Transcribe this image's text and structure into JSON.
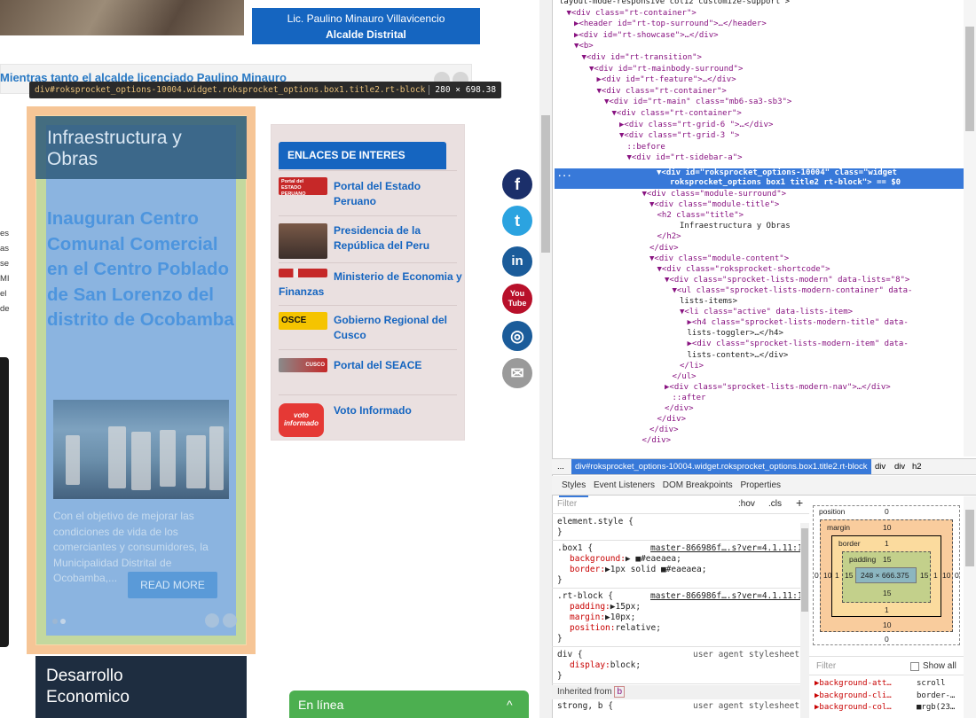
{
  "page": {
    "mayor_name": "Lic. Paulino Minauro Villavicencio",
    "mayor_title": "Alcalde Distrital",
    "ticker_text": "Mientras tanto el alcalde licenciado Paulino Minauro",
    "tooltip_selector": "div#roksprocket_options-10004.widget.roksprocket_options.box1.title2.rt-block",
    "tooltip_size": "280 × 698.38",
    "box_title": "Infraestructura y Obras",
    "article_title": "Inauguran Centro Comunal Comercial en el Centro Poblado de San Lorenzo del distrito de Ocobamba",
    "article_body": "Con el objetivo de mejorar las condiciones de vida de los comerciantes y consumidores, la Municipalidad Distrital de Ocobamba,...",
    "read_more": "READ MORE",
    "left_fragments": [
      "es",
      "as",
      "se",
      "MI",
      "el",
      "de"
    ],
    "links_header": "ENLACES DE INTERES",
    "links": [
      {
        "label": "Portal del Estado Peruano",
        "thumb": "estado-peruano-logo"
      },
      {
        "label": "Presidencia de la República del Peru",
        "thumb": "presidente-photo"
      },
      {
        "label": "Ministerio de Economia y Finanzas",
        "thumb": "mef-logo"
      },
      {
        "label": "Gobierno Regional del Cusco",
        "thumb": "osce-logo"
      },
      {
        "label": "Portal del SEACE",
        "thumb": "cusco-logo"
      },
      {
        "label": "Voto Informado",
        "thumb": "voto-informado-logo"
      }
    ],
    "thumb_texts": {
      "estado": "Portal del ESTADO PERUANO",
      "osce": "OSCE",
      "cusco": "CUSCO",
      "voto": "voto informado"
    },
    "social": [
      {
        "name": "facebook",
        "glyph": "f",
        "color": "#1b2f6a"
      },
      {
        "name": "twitter",
        "glyph": "t",
        "color": "#2ba3e0"
      },
      {
        "name": "linkedin",
        "glyph": "in",
        "color": "#1b5c9a"
      },
      {
        "name": "youtube",
        "glyph": "You Tube",
        "color": "#b8102a"
      },
      {
        "name": "instagram",
        "glyph": "◎",
        "color": "#1b5c9a"
      },
      {
        "name": "email",
        "glyph": "✉",
        "color": "#9a9a9a"
      }
    ],
    "bottom_section": "Desarrollo Economico",
    "chat_label": "En línea",
    "chat_toggle": "^"
  },
  "devtools": {
    "dom_lines": [
      {
        "indent": 0,
        "html": "layout-mode-responsive col12 customize-support\">"
      },
      {
        "indent": 1,
        "html": "▼<div class=\"rt-container\">"
      },
      {
        "indent": 2,
        "html": "▶<header id=\"rt-top-surround\">…</header>"
      },
      {
        "indent": 2,
        "html": "▶<div id=\"rt-showcase\">…</div>"
      },
      {
        "indent": 2,
        "html": "▼<b>"
      },
      {
        "indent": 3,
        "html": "▼<div id=\"rt-transition\">"
      },
      {
        "indent": 4,
        "html": "▼<div id=\"rt-mainbody-surround\">"
      },
      {
        "indent": 5,
        "html": "▶<div id=\"rt-feature\">…</div>"
      },
      {
        "indent": 5,
        "html": "▼<div class=\"rt-container\">"
      },
      {
        "indent": 6,
        "html": "▼<div id=\"rt-main\" class=\"mb6-sa3-sb3\">"
      },
      {
        "indent": 7,
        "html": "▼<div class=\"rt-container\">"
      },
      {
        "indent": 8,
        "html": "▶<div class=\"rt-grid-6 \">…</div>"
      },
      {
        "indent": 8,
        "html": "▼<div class=\"rt-grid-3 \">"
      },
      {
        "indent": 9,
        "html": "::before"
      },
      {
        "indent": 9,
        "html": "▼<div id=\"rt-sidebar-a\">"
      }
    ],
    "selected_line1": "▼<div id=\"roksprocket_options-10004\" class=\"widget",
    "selected_line2": "roksprocket_options box1 title2 rt-block\"> == $0",
    "dom_lines_after": [
      {
        "indent": 11,
        "html": "▼<div class=\"module-surround\">"
      },
      {
        "indent": 12,
        "html": "▼<div class=\"module-title\">"
      },
      {
        "indent": 13,
        "html": "<h2 class=\"title\">"
      },
      {
        "indent": 16,
        "html": "Infraestructura y Obras"
      },
      {
        "indent": 13,
        "html": "</h2>"
      },
      {
        "indent": 12,
        "html": "</div>"
      },
      {
        "indent": 12,
        "html": "▼<div class=\"module-content\">"
      },
      {
        "indent": 13,
        "html": "▼<div class=\"roksprocket-shortcode\">"
      },
      {
        "indent": 14,
        "html": "▼<div class=\"sprocket-lists-modern\" data-lists=\"8\">"
      },
      {
        "indent": 15,
        "html": "▼<ul class=\"sprocket-lists-modern-container\" data-"
      },
      {
        "indent": 16,
        "html": "lists-items>"
      },
      {
        "indent": 16,
        "html": "▼<li class=\"active\" data-lists-item>"
      },
      {
        "indent": 17,
        "html": "▶<h4 class=\"sprocket-lists-modern-title\" data-"
      },
      {
        "indent": 17,
        "html": "lists-toggler>…</h4>"
      },
      {
        "indent": 17,
        "html": "▶<div class=\"sprocket-lists-modern-item\" data-"
      },
      {
        "indent": 17,
        "html": "lists-content>…</div>"
      },
      {
        "indent": 16,
        "html": "</li>"
      },
      {
        "indent": 15,
        "html": "</ul>"
      },
      {
        "indent": 14,
        "html": "▶<div class=\"sprocket-lists-modern-nav\">…</div>"
      },
      {
        "indent": 15,
        "html": "::after"
      },
      {
        "indent": 14,
        "html": "</div>"
      },
      {
        "indent": 13,
        "html": "</div>"
      },
      {
        "indent": 12,
        "html": "</div>"
      },
      {
        "indent": 11,
        "html": "</div>"
      }
    ],
    "crumb_dots": "...",
    "crumb_active": "div#roksprocket_options-10004.widget.roksprocket_options.box1.title2.rt-block",
    "crumbs_rest": [
      "div",
      "div",
      "h2"
    ],
    "tabs": [
      "Styles",
      "Event Listeners",
      "DOM Breakpoints",
      "Properties"
    ],
    "filter_placeholder": "Filter",
    "hov": ":hov",
    "cls": ".cls",
    "plus": "+",
    "rules": [
      {
        "selector": "element.style {",
        "source": "",
        "props": [],
        "close": "}"
      },
      {
        "selector": ".box1 {",
        "source": "master-866986f….s?ver=4.1.11:1",
        "props": [
          [
            "background",
            "▶ ■#eaeaea;"
          ],
          [
            "border",
            "▶1px solid ■#eaeaea;"
          ]
        ],
        "close": "}"
      },
      {
        "selector": ".rt-block {",
        "source": "master-866986f….s?ver=4.1.11:1",
        "props": [
          [
            "padding",
            "▶15px;"
          ],
          [
            "margin",
            "▶10px;"
          ],
          [
            "position",
            "relative;"
          ]
        ],
        "close": "}"
      },
      {
        "selector": "div {",
        "source": "user agent stylesheet",
        "props": [
          [
            "display",
            "block;"
          ]
        ],
        "close": "}"
      }
    ],
    "inherited_from": "Inherited from",
    "inherited_tag": "b",
    "last_rule": "strong, b {",
    "last_rule_src": "user agent stylesheet",
    "boxmodel": {
      "position_label": "position",
      "position_val": "0",
      "margin_label": "margin",
      "margin_val": "10",
      "border_label": "border",
      "border_val": "1",
      "padding_label": "padding",
      "padding_val": "15",
      "content": "248 × 666.375",
      "left_outer": "0",
      "left_margin": "10",
      "left_border": "1",
      "left_padding": "15",
      "right_padding": "15",
      "right_border": "1",
      "right_margin": "10",
      "right_outer": "0",
      "bottom_padding": "15",
      "bottom_border": "1",
      "bottom_margin": "10",
      "bottom_outer": "0"
    },
    "computed_filter": "Filter",
    "show_all": "Show all",
    "computed": [
      {
        "prop": "background-att…",
        "val": "scroll"
      },
      {
        "prop": "background-cli…",
        "val": "border-…"
      },
      {
        "prop": "background-col…",
        "val": "■rgb(23…"
      }
    ]
  }
}
